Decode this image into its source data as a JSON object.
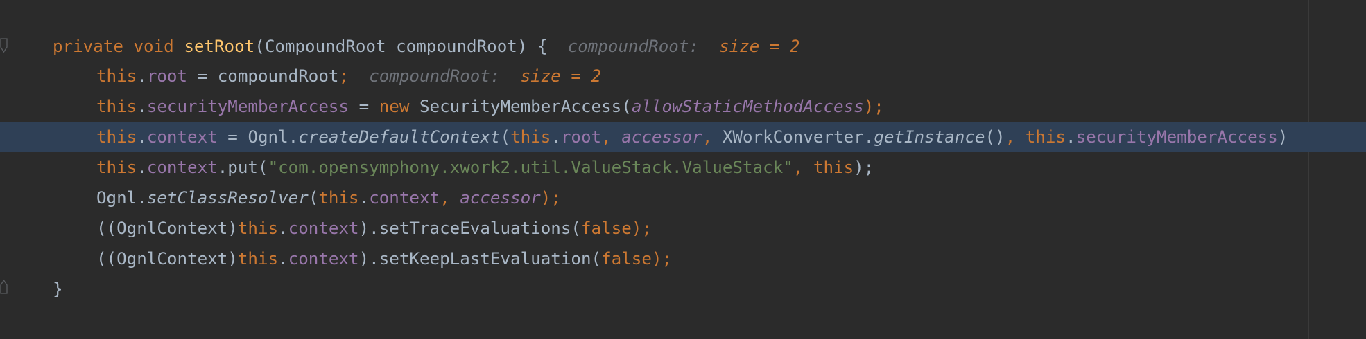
{
  "editor": {
    "hint_label": "compoundRoot:",
    "hint_value": "size = 2",
    "lines": [
      {
        "modifier": "private",
        "ret": "void",
        "name": "setRoot",
        "open_paren": "(",
        "param_type": "CompoundRoot",
        "param_name": "compoundRoot",
        "close": ") {"
      },
      {
        "this": "this",
        "dot": ".",
        "field": "root",
        "eq": " = ",
        "value": "compoundRoot",
        "semi": ";"
      },
      {
        "this": "this",
        "dot": ".",
        "field": "securityMemberAccess",
        "eq": " = ",
        "new_kw": "new",
        "class": "SecurityMemberAccess",
        "open": "(",
        "arg": "allowStaticMethodAccess",
        "close": ");"
      },
      {
        "this": "this",
        "dot": ".",
        "field": "context",
        "eq": " = ",
        "cls": "Ognl.",
        "method": "createDefaultContext",
        "open": "(",
        "this2": "this",
        "field2": "root",
        "comma": ", ",
        "accessor": "accessor",
        "converter": "XWorkConverter.",
        "get_instance": "getInstance",
        "parens": "()",
        "this3": "this",
        "field3": "securityMemberAccess",
        "end": ")"
      },
      {
        "this": "this",
        "dot": ".",
        "field": "context",
        "call": ".put(",
        "string": "\"com.opensymphony.xwork2.util.ValueStack.ValueStack\"",
        "comma": ", ",
        "this2": "this",
        "close": ");"
      },
      {
        "cls": "Ognl.",
        "method": "setClassResolver",
        "open": "(",
        "this": "this",
        "dot": ".",
        "field": "context",
        "comma": ", ",
        "accessor": "accessor",
        "close": ");"
      },
      {
        "cast": "((OgnlContext)",
        "this": "this",
        "dot": ".",
        "field": "context",
        "call": ").setTraceEvaluations(",
        "bool": "false",
        "close": ");"
      },
      {
        "cast": "((OgnlContext)",
        "this": "this",
        "dot": ".",
        "field": "context",
        "call": ").setKeepLastEvaluation(",
        "bool": "false",
        "close": ");"
      },
      {
        "brace": "}"
      }
    ]
  },
  "colors": {
    "background": "#2b2b2b",
    "current_line": "#2f4056",
    "keyword": "#cc7832",
    "method_declaration": "#ffc66d",
    "field": "#9876aa",
    "string": "#6a8759",
    "default_text": "#a9b7c6",
    "inlay_hint": "#6f737a"
  },
  "icons": [
    "fold-start-icon",
    "fold-end-icon"
  ]
}
